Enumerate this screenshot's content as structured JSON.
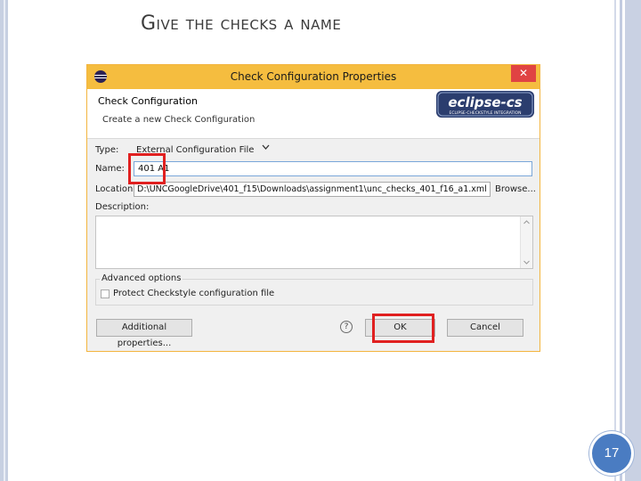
{
  "slide": {
    "title": "Give the checks a name",
    "page_number": "17"
  },
  "window": {
    "title": "Check Configuration Properties",
    "close_glyph": "✕"
  },
  "header": {
    "title": "Check Configuration",
    "subtitle": "Create a new Check Configuration",
    "logo_text": "eclipse-cs",
    "logo_tagline": "ECLIPSE-CHECKSTYLE INTEGRATION"
  },
  "form": {
    "type_label": "Type:",
    "type_value": "External Configuration File",
    "name_label": "Name:",
    "name_value": "401 A1",
    "location_label": "Location:",
    "location_value": "D:\\UNCGoogleDrive\\401_f15\\Downloads\\assignment1\\unc_checks_401_f16_a1.xml",
    "browse_label": "Browse...",
    "description_label": "Description:",
    "description_value": ""
  },
  "advanced": {
    "legend": "Advanced options",
    "protect_label": "Protect Checkstyle configuration file"
  },
  "buttons": {
    "additional_properties": "Additional properties...",
    "help_glyph": "?",
    "ok": "OK",
    "cancel": "Cancel"
  },
  "colors": {
    "titlebar": "#f5bd3f",
    "highlight": "#e02020",
    "page_number_bg": "#4a7cc2"
  }
}
